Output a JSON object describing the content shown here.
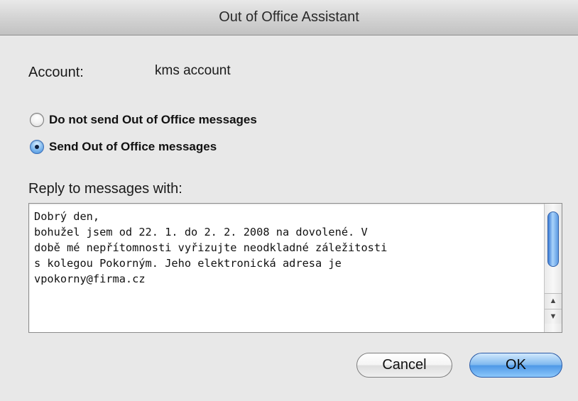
{
  "window": {
    "title": "Out of Office Assistant"
  },
  "account": {
    "label": "Account:",
    "value": "kms account"
  },
  "options": [
    {
      "label": "Do not send Out of Office messages",
      "selected": false
    },
    {
      "label": "Send Out of Office messages",
      "selected": true
    }
  ],
  "reply": {
    "label": "Reply to messages with:",
    "text": "Dobrý den,\nbohužel jsem od 22. 1. do 2. 2. 2008 na dovolené. V\ndobě mé nepřítomnosti vyřizujte neodkladné záležitosti\ns kolegou Pokorným. Jeho elektronická adresa je\nvpokorny@firma.cz"
  },
  "buttons": {
    "cancel": "Cancel",
    "ok": "OK"
  },
  "colors": {
    "window_bg": "#e8e8e8",
    "accent_blue": "#4d97e6"
  }
}
